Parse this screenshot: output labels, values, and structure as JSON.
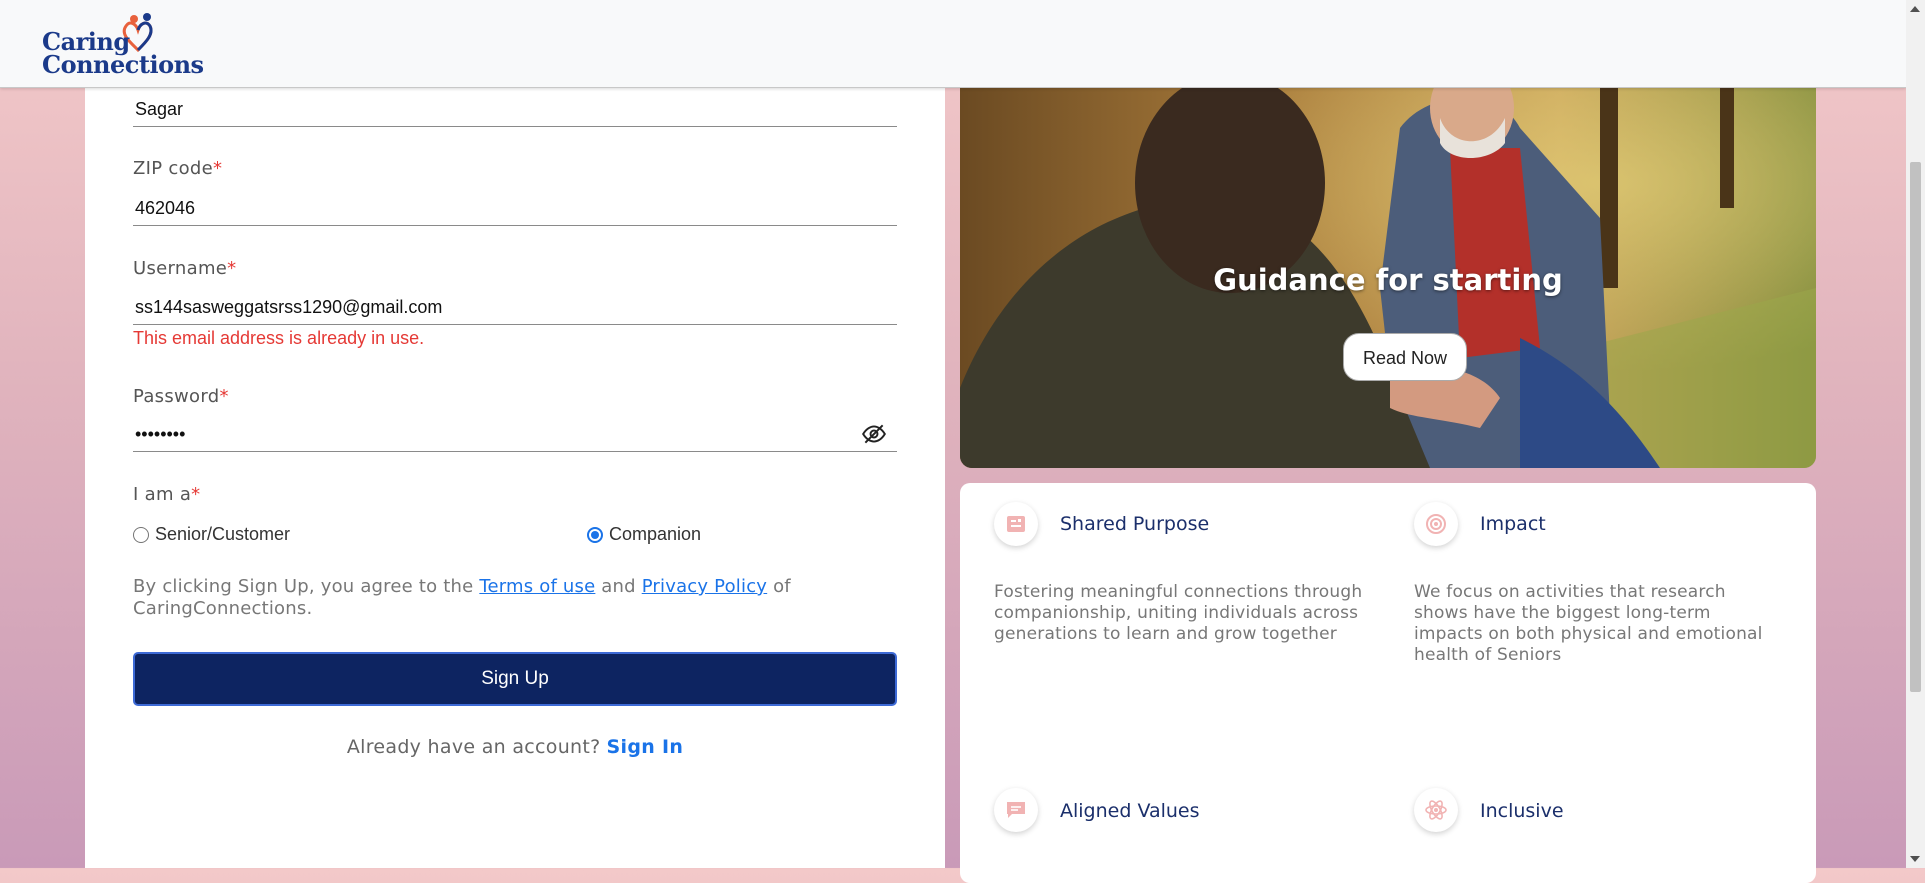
{
  "brand": {
    "name_line1": "Caring",
    "name_line2": "Connections"
  },
  "form": {
    "city_value": "Sagar",
    "zip": {
      "label": "ZIP code",
      "value": "462046"
    },
    "username": {
      "label": "Username",
      "value": "ss144sasweggatsrss1290@gmail.com",
      "error": "This email address is already in use."
    },
    "password": {
      "label": "Password",
      "value": "••••••••"
    },
    "role": {
      "label": "I am a",
      "options": [
        "Senior/Customer",
        "Companion"
      ],
      "selected": "Companion"
    },
    "required_mark": "*",
    "terms": {
      "prefix": "By clicking Sign Up, you agree to the",
      "terms_link": "Terms of use",
      "and": "and",
      "privacy_link": "Privacy Policy",
      "suffix": "of CaringConnections."
    },
    "signup_button": "Sign Up",
    "signin_prompt": "Already have an account?",
    "signin_link": "Sign In"
  },
  "hero": {
    "title": "Guidance for starting",
    "button": "Read Now"
  },
  "features": [
    {
      "icon": "list-icon",
      "title": "Shared Purpose",
      "description": "Fostering meaningful connections through companionship, uniting individuals across generations to learn and grow together"
    },
    {
      "icon": "target-icon",
      "title": "Impact",
      "description": "We focus on activities that research shows have the biggest long-term impacts on both physical and emotional health of Seniors"
    },
    {
      "icon": "chat-icon",
      "title": "Aligned Values",
      "description": ""
    },
    {
      "icon": "atom-icon",
      "title": "Inclusive",
      "description": ""
    }
  ],
  "colors": {
    "primary": "#0d2461",
    "link": "#1a73e8",
    "error": "#e53935",
    "accent_icon": "#e8a0a0"
  }
}
